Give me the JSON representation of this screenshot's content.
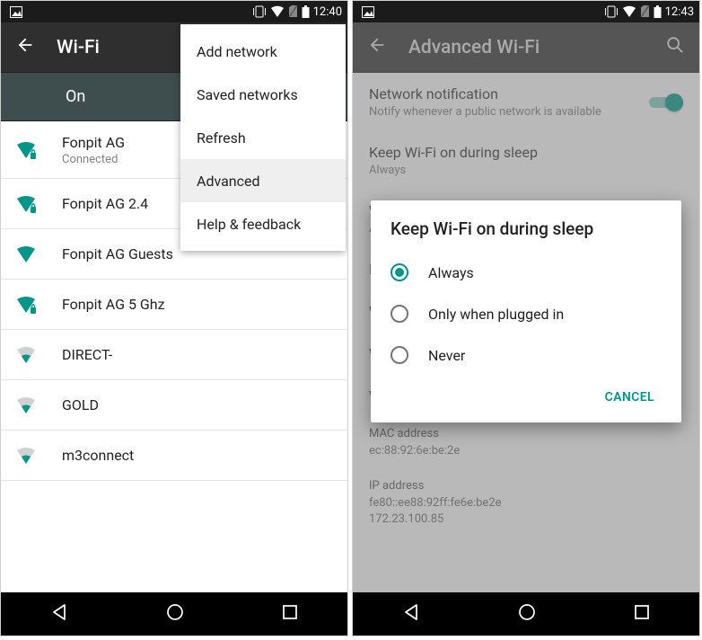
{
  "left": {
    "status": {
      "time": "12:40"
    },
    "appbar": {
      "title": "Wi-Fi"
    },
    "toggle": {
      "label": "On"
    },
    "wifi": [
      {
        "name": "Fonpit AG",
        "sub": "Connected",
        "strong": true,
        "locked": true
      },
      {
        "name": "Fonpit AG 2.4",
        "strong": true,
        "locked": true
      },
      {
        "name": "Fonpit AG Guests",
        "strong": true,
        "locked": false
      },
      {
        "name": "Fonpit AG 5 Ghz",
        "strong": true,
        "locked": true
      },
      {
        "name": "DIRECT-",
        "strong": false,
        "locked": false
      },
      {
        "name": "GOLD",
        "strong": false,
        "locked": false
      },
      {
        "name": "m3connect",
        "strong": false,
        "locked": false
      }
    ],
    "menu": [
      {
        "label": "Add network"
      },
      {
        "label": "Saved networks"
      },
      {
        "label": "Refresh"
      },
      {
        "label": "Advanced",
        "highlight": true
      },
      {
        "label": "Help & feedback"
      }
    ]
  },
  "right": {
    "status": {
      "time": "12:43"
    },
    "appbar": {
      "title": "Advanced Wi-Fi"
    },
    "settings": {
      "notif_title": "Network notification",
      "notif_sub": "Notify whenever a public network is available",
      "sleep_title": "Keep Wi-Fi on during sleep",
      "sleep_value": "Always",
      "row_w": "W",
      "row_a": "A",
      "row_i": "I",
      "row_w2": "W",
      "row_w3": "W",
      "wps_title": "WPS Pin Entry",
      "mac_label": "MAC address",
      "mac_value": "ec:88:92:6e:be:2e",
      "ip_label": "IP address",
      "ip_line1": "fe80::ee88:92ff:fe6e:be2e",
      "ip_line2": "172.23.100.85"
    },
    "dialog": {
      "title": "Keep Wi-Fi on during sleep",
      "options": [
        {
          "label": "Always",
          "checked": true
        },
        {
          "label": "Only when plugged in",
          "checked": false
        },
        {
          "label": "Never",
          "checked": false
        }
      ],
      "cancel": "CANCEL"
    }
  }
}
